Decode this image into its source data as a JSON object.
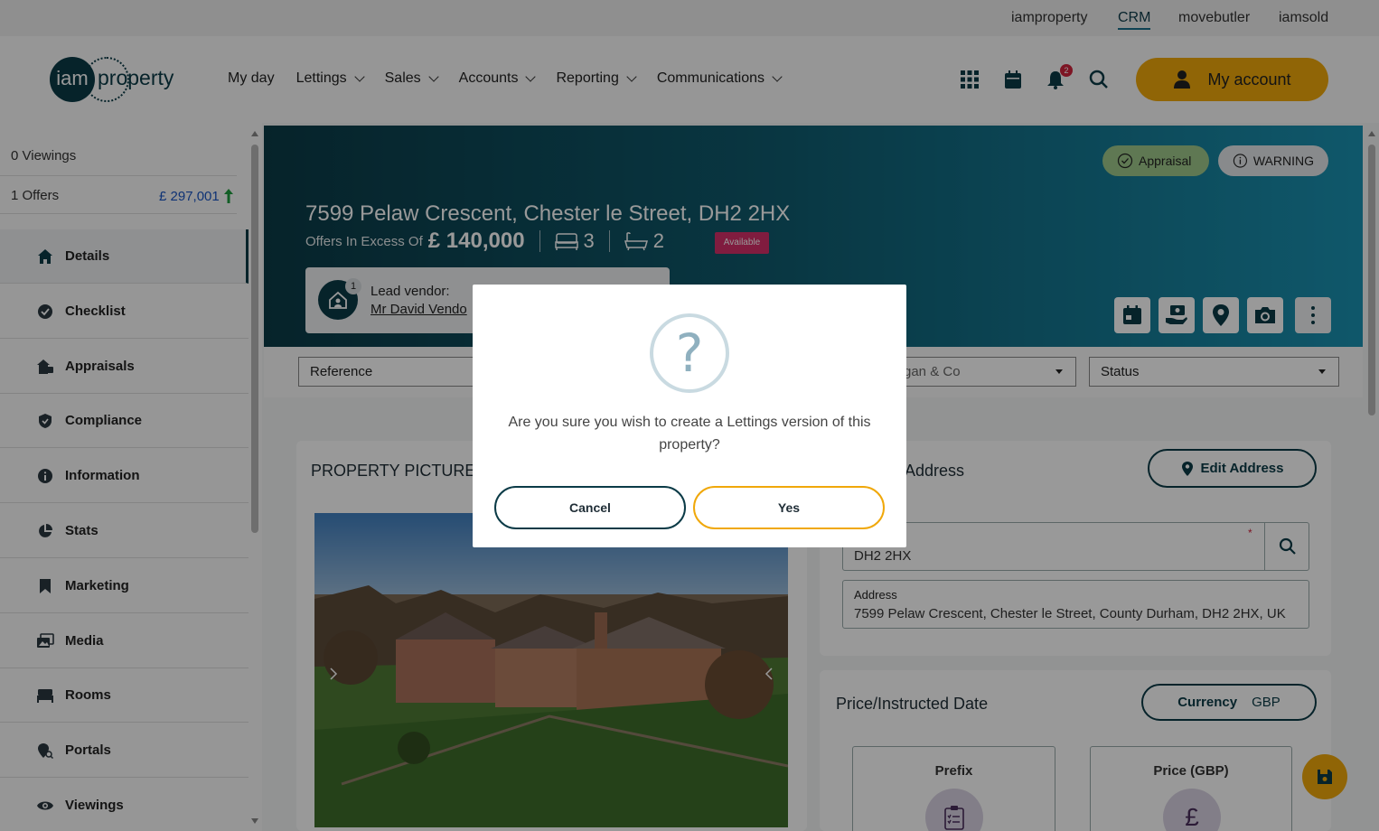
{
  "topbar": {
    "links": [
      "iamproperty",
      "CRM",
      "movebutler",
      "iamsold"
    ],
    "active": "CRM"
  },
  "header": {
    "logo": {
      "mark": "iam",
      "text": "property"
    },
    "nav": [
      "My day",
      "Lettings",
      "Sales",
      "Accounts",
      "Reporting",
      "Communications"
    ],
    "notification_count": "2",
    "account_label": "My account",
    "icons": [
      "apps-grid-icon",
      "calendar-icon",
      "bell-icon",
      "search-icon"
    ]
  },
  "sidebar": {
    "viewings": "0 Viewings",
    "offers": "1 Offers",
    "offer_value": "£ 297,001",
    "items": [
      {
        "label": "Details",
        "icon": "home-icon",
        "active": true
      },
      {
        "label": "Checklist",
        "icon": "check-circle-icon"
      },
      {
        "label": "Appraisals",
        "icon": "house-tag-icon"
      },
      {
        "label": "Compliance",
        "icon": "shield-check-icon"
      },
      {
        "label": "Information",
        "icon": "info-icon"
      },
      {
        "label": "Stats",
        "icon": "pie-chart-icon"
      },
      {
        "label": "Marketing",
        "icon": "bookmark-icon"
      },
      {
        "label": "Media",
        "icon": "images-icon"
      },
      {
        "label": "Rooms",
        "icon": "bed-icon"
      },
      {
        "label": "Portals",
        "icon": "map-pin-search-icon"
      },
      {
        "label": "Viewings",
        "icon": "eye-icon"
      }
    ]
  },
  "hero": {
    "address": "7599 Pelaw Crescent, Chester le Street, DH2 2HX",
    "price_prefix": "Offers In Excess Of",
    "price": "£ 140,000",
    "bedrooms": "3",
    "bathrooms": "2",
    "availability": "Available",
    "pill_appraisal": "Appraisal",
    "pill_warning": "WARNING",
    "vendor_label": "Lead vendor:",
    "vendor_name": "Mr David Vendo",
    "vendor_count": "1"
  },
  "filters": {
    "reference": "Reference",
    "branch": "rgan & Co",
    "status": "Status"
  },
  "pictures": {
    "title": "PROPERTY PICTURES"
  },
  "address_card": {
    "title": "Address",
    "edit_label": "Edit Address",
    "postcode_label": "e",
    "postcode_value": "DH2 2HX",
    "address_label": "Address",
    "address_value": "7599 Pelaw Crescent, Chester le Street, County Durham, DH2 2HX, UK"
  },
  "price_card": {
    "title": "Price/Instructed Date",
    "currency_label": "Currency",
    "currency_value": "GBP",
    "prefix_label": "Prefix",
    "price_label": "Price (GBP)",
    "price_symbol": "£"
  },
  "modal": {
    "icon_glyph": "?",
    "message": "Are you sure you wish to create a Lettings version of this property?",
    "cancel_label": "Cancel",
    "yes_label": "Yes"
  },
  "colors": {
    "brand_dark": "#0b3b47",
    "accent": "#f0a80a",
    "available": "#d6306a",
    "appraisal": "#9ec98a"
  }
}
